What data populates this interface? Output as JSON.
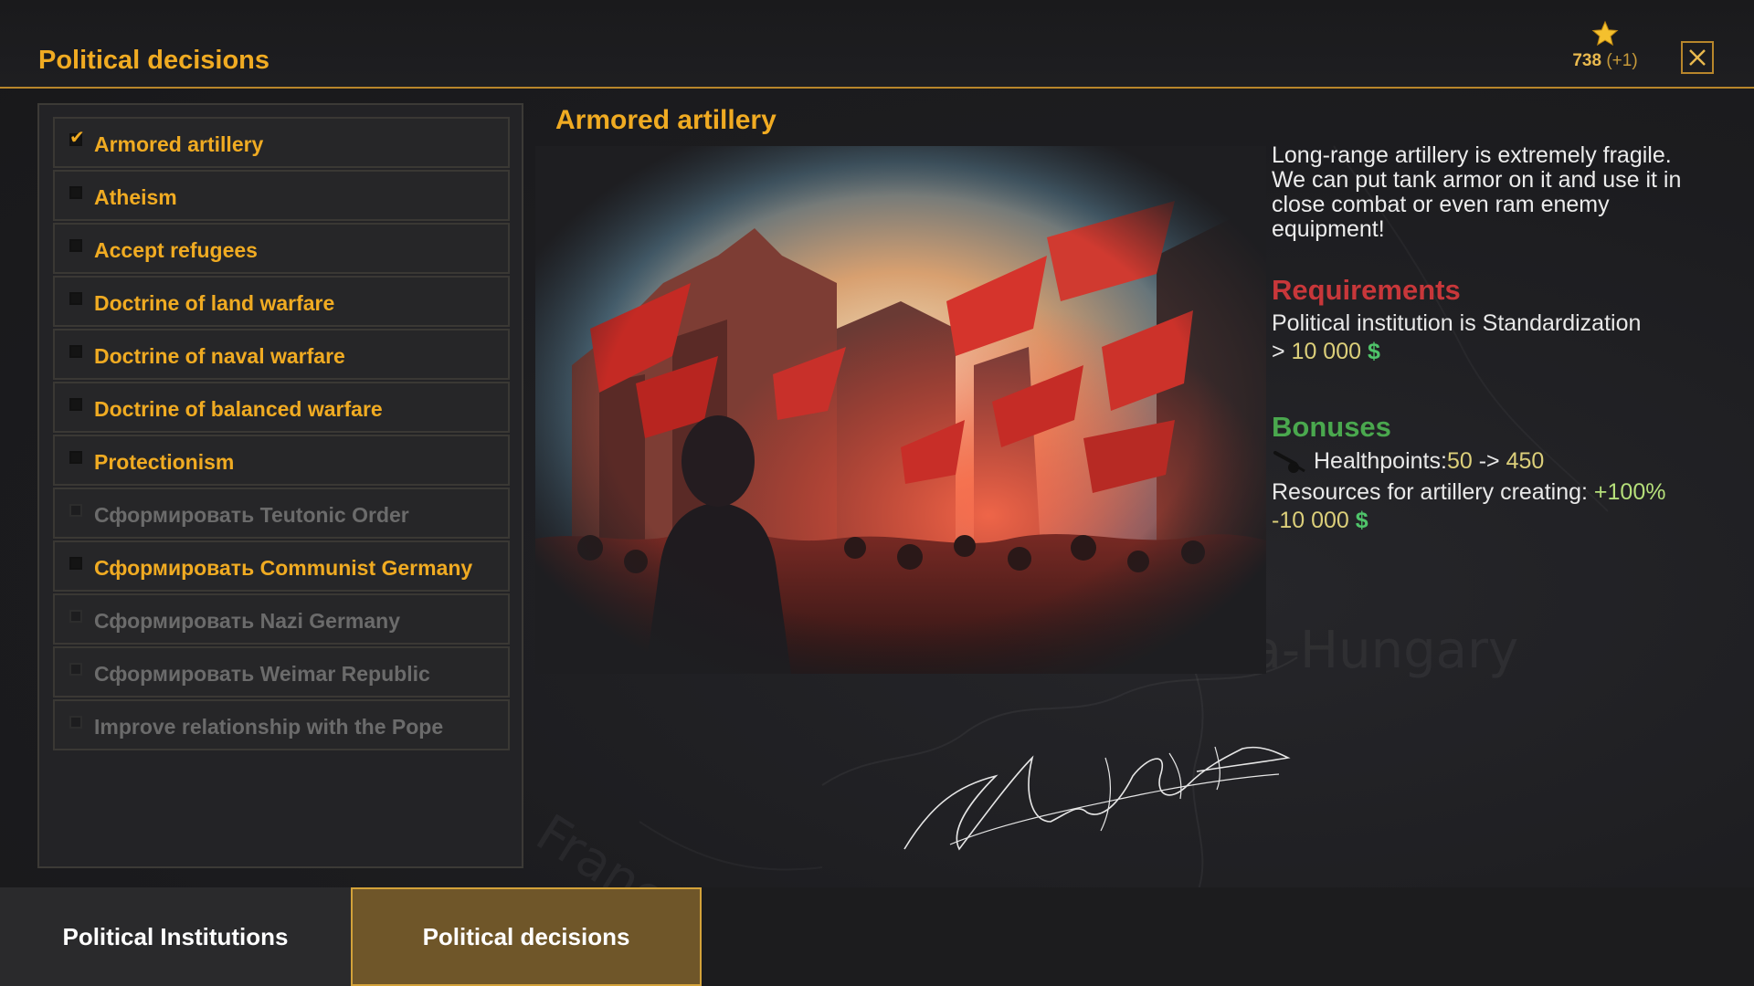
{
  "header": {
    "title": "Political decisions",
    "score": "738",
    "score_delta": "(+1)",
    "star_icon": "star-icon",
    "close_icon": "close-icon"
  },
  "decisions": [
    {
      "label": "Armored artillery",
      "state": "selected"
    },
    {
      "label": "Atheism",
      "state": "available"
    },
    {
      "label": "Accept refugees",
      "state": "available"
    },
    {
      "label": "Doctrine of land warfare",
      "state": "available"
    },
    {
      "label": "Doctrine of naval warfare",
      "state": "available"
    },
    {
      "label": "Doctrine of balanced warfare",
      "state": "available"
    },
    {
      "label": "Protectionism",
      "state": "available"
    },
    {
      "label": "Сформировать Teutonic Order",
      "state": "disabled"
    },
    {
      "label": "Сформировать Communist Germany",
      "state": "available"
    },
    {
      "label": "Сформировать Nazi Germany",
      "state": "disabled"
    },
    {
      "label": "Сформировать Weimar Republic",
      "state": "disabled"
    },
    {
      "label": "Improve relationship with the Pope",
      "state": "disabled"
    }
  ],
  "detail": {
    "title": "Armored artillery",
    "description": "Long-range artillery is extremely fragile. We can put tank armor on it and use it in close combat or even ram enemy equipment!",
    "requirements_title": "Requirements",
    "requirement_institution": "Political institution is Standardization",
    "requirement_money_prefix": "> ",
    "requirement_money": "10 000",
    "currency_symbol": "$",
    "bonuses_title": "Bonuses",
    "bonus_icon": "artillery-icon",
    "healthpoints_label": "Healthpoints: ",
    "healthpoints_from": "50",
    "healthpoints_arrow": " -> ",
    "healthpoints_to": "450",
    "resources_label": "Resources for artillery creating: ",
    "resources_value": "+100%",
    "cost": "-10 000"
  },
  "map_labels": [
    "Austria-Hungary",
    "France"
  ],
  "tabs": [
    {
      "label": "Political Institutions",
      "active": false
    },
    {
      "label": "Political decisions",
      "active": true
    }
  ],
  "colors": {
    "accent": "#f0ab22",
    "requirements": "#c8373a",
    "bonuses": "#4aa84e",
    "money": "#4fc46a",
    "disabled": "#6b6b6b"
  }
}
